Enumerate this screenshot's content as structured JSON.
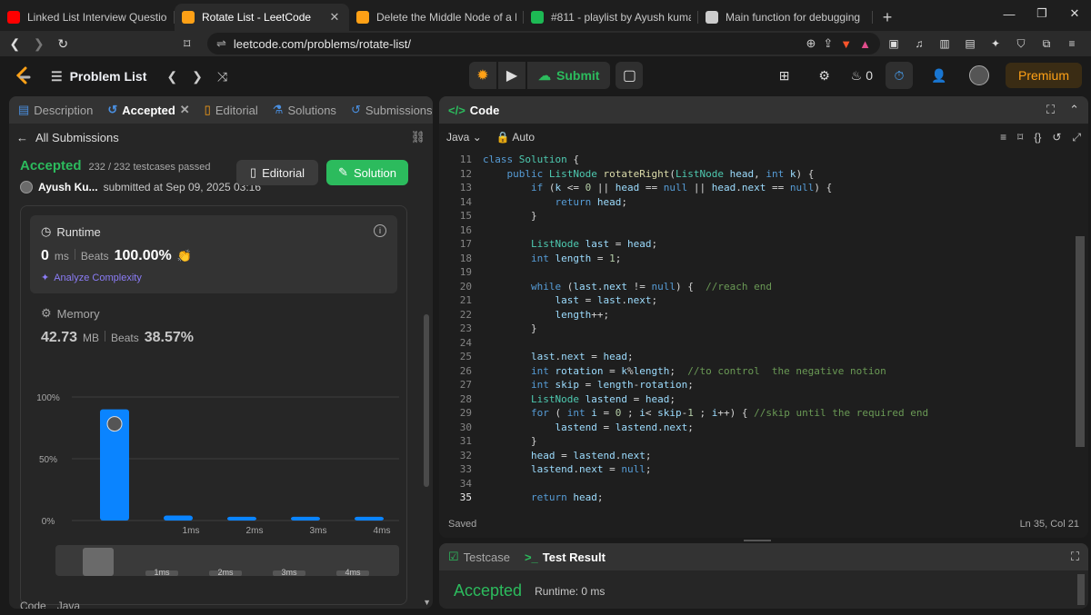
{
  "browser": {
    "tabs": [
      {
        "title": "Linked List Interview Questions - Goo",
        "favicon": "youtube-icon",
        "color": "#ff0000"
      },
      {
        "title": "Rotate List - LeetCode",
        "favicon": "leetcode-icon",
        "color": "#ffa116",
        "active": true
      },
      {
        "title": "Delete the Middle Node of a Linked L",
        "favicon": "leetcode-icon",
        "color": "#ffa116"
      },
      {
        "title": "#811 - playlist by Ayush kumar | Spot",
        "favicon": "spotify-icon",
        "color": "#1db954"
      },
      {
        "title": "Main function for debugging",
        "favicon": "chatgpt-icon",
        "color": "#cccccc"
      }
    ],
    "url": "leetcode.com/problems/rotate-list/",
    "brave_badge": "4"
  },
  "header": {
    "problem_list": "Problem List",
    "submit": "Submit",
    "streak": "0",
    "premium": "Premium"
  },
  "left_panel": {
    "tabs": [
      "Description",
      "Accepted",
      "Editorial",
      "Solutions",
      "Submissions"
    ],
    "all_submissions": "All Submissions",
    "status": "Accepted",
    "testcases": "232 / 232 testcases passed",
    "user": "Ayush Ku...",
    "submitted": "submitted at Sep 09, 2025 03:16",
    "editorial_btn": "Editorial",
    "solution_btn": "Solution",
    "runtime": {
      "label": "Runtime",
      "value": "0",
      "unit": "ms",
      "beats_label": "Beats",
      "beats": "100.00%",
      "analyze": "Analyze Complexity"
    },
    "memory": {
      "label": "Memory",
      "value": "42.73",
      "unit": "MB",
      "beats_label": "Beats",
      "beats": "38.57%"
    },
    "footer_tabs": [
      "Code",
      "Java"
    ]
  },
  "chart_data": {
    "type": "bar",
    "y_ticks": [
      "100%",
      "50%",
      "0%"
    ],
    "ylim": [
      0,
      100
    ],
    "categories": [
      "0ms",
      "1ms",
      "2ms",
      "3ms",
      "4ms"
    ],
    "values": [
      90,
      4,
      3,
      3,
      3
    ],
    "highlighted": "0ms",
    "grid": true,
    "accent": "#0a84ff",
    "x_labels": [
      "",
      "1ms",
      "2ms",
      "3ms",
      "4ms"
    ],
    "mini_labels": [
      "1ms",
      "2ms",
      "3ms",
      "4ms"
    ]
  },
  "editor": {
    "title": "Code",
    "language": "Java",
    "mode": "Auto",
    "saved": "Saved",
    "position": "Ln 35, Col 21",
    "lines": [
      {
        "n": 11,
        "html": "<span class='kw'>class</span> <span class='ty'>Solution</span> {"
      },
      {
        "n": 12,
        "html": "    <span class='kw'>public</span> <span class='ty'>ListNode</span> <span class='fn'>rotateRight</span>(<span class='ty'>ListNode</span> <span class='vr'>head</span>, <span class='kw'>int</span> <span class='vr'>k</span>) {"
      },
      {
        "n": 13,
        "html": "        <span class='kw'>if</span> (<span class='vr'>k</span> &lt;= <span class='nm'>0</span> || <span class='vr'>head</span> == <span class='kw'>null</span> || <span class='vr'>head</span>.<span class='vr'>next</span> == <span class='kw'>null</span>) {"
      },
      {
        "n": 14,
        "html": "            <span class='kw'>return</span> <span class='vr'>head</span>;"
      },
      {
        "n": 15,
        "html": "        }"
      },
      {
        "n": 16,
        "html": ""
      },
      {
        "n": 17,
        "html": "        <span class='ty'>ListNode</span> <span class='vr'>last</span> = <span class='vr'>head</span>;"
      },
      {
        "n": 18,
        "html": "        <span class='kw'>int</span> <span class='vr'>length</span> = <span class='nm'>1</span>;"
      },
      {
        "n": 19,
        "html": ""
      },
      {
        "n": 20,
        "html": "        <span class='kw'>while</span> (<span class='vr'>last</span>.<span class='vr'>next</span> != <span class='kw'>null</span>) {  <span class='cm'>//reach end</span>"
      },
      {
        "n": 21,
        "html": "            <span class='vr'>last</span> = <span class='vr'>last</span>.<span class='vr'>next</span>;"
      },
      {
        "n": 22,
        "html": "            <span class='vr'>length</span>++;"
      },
      {
        "n": 23,
        "html": "        }"
      },
      {
        "n": 24,
        "html": ""
      },
      {
        "n": 25,
        "html": "        <span class='vr'>last</span>.<span class='vr'>next</span> = <span class='vr'>head</span>;"
      },
      {
        "n": 26,
        "html": "        <span class='kw'>int</span> <span class='vr'>rotation</span> = <span class='vr'>k</span>%<span class='vr'>length</span>;  <span class='cm'>//to control  the negative notion</span>"
      },
      {
        "n": 27,
        "html": "        <span class='kw'>int</span> <span class='vr'>skip</span> = <span class='vr'>length</span>-<span class='vr'>rotation</span>;"
      },
      {
        "n": 28,
        "html": "        <span class='ty'>ListNode</span> <span class='vr'>lastend</span> = <span class='vr'>head</span>;"
      },
      {
        "n": 29,
        "html": "        <span class='kw'>for</span> ( <span class='kw'>int</span> <span class='vr'>i</span> = <span class='nm'>0</span> ; <span class='vr'>i</span>&lt; <span class='vr'>skip</span>-<span class='nm'>1</span> ; <span class='vr'>i</span>++) { <span class='cm'>//skip until the required end</span>"
      },
      {
        "n": 30,
        "html": "            <span class='vr'>lastend</span> = <span class='vr'>lastend</span>.<span class='vr'>next</span>;"
      },
      {
        "n": 31,
        "html": "        }"
      },
      {
        "n": 32,
        "html": "        <span class='vr'>head</span> = <span class='vr'>lastend</span>.<span class='vr'>next</span>;"
      },
      {
        "n": 33,
        "html": "        <span class='vr'>lastend</span>.<span class='vr'>next</span> = <span class='kw'>null</span>;"
      },
      {
        "n": 34,
        "html": ""
      },
      {
        "n": 35,
        "html": "        <span class='kw'>return</span> <span class='vr'>head</span>;"
      }
    ]
  },
  "bottom": {
    "testcase": "Testcase",
    "test_result": "Test Result",
    "status": "Accepted",
    "runtime": "Runtime: 0 ms"
  }
}
